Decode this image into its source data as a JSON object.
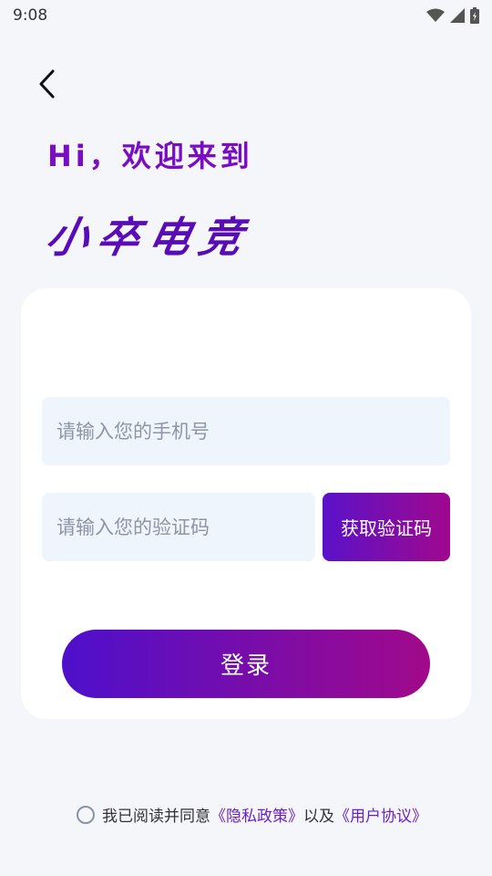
{
  "status_bar": {
    "time": "9:08",
    "icons": [
      "wifi-icon",
      "signal-icon",
      "battery-icon"
    ]
  },
  "header": {
    "greeting": "Hi，欢迎来到",
    "brand": "小卒电竞"
  },
  "form": {
    "phone_placeholder": "请输入您的手机号",
    "phone_value": "",
    "code_placeholder": "请输入您的验证码",
    "code_value": "",
    "get_code_label": "获取验证码",
    "login_label": "登录"
  },
  "agreement": {
    "prefix": "我已阅读并同意",
    "privacy_link": "《隐私政策》",
    "connector": "以及",
    "user_link": "《用户协议》",
    "checked": false
  },
  "colors": {
    "accent_start": "#4d10cc",
    "accent_end": "#a1098a",
    "brand": "#5a0bb8",
    "link": "#6b1fc7"
  }
}
